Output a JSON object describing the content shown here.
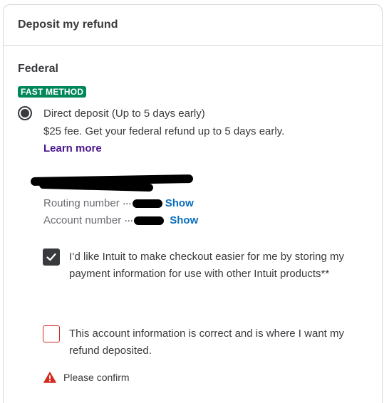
{
  "card": {
    "title": "Deposit my refund"
  },
  "federal": {
    "heading": "Federal",
    "badge": "FAST METHOD",
    "option": {
      "title": "Direct deposit (Up to 5 days early)",
      "description": "$25 fee. Get your federal refund up to 5 days early.",
      "learn_more": "Learn more",
      "selected": true
    },
    "account": {
      "routing_label": "Routing number",
      "account_label": "Account number",
      "mask": "···",
      "show_label": "Show"
    },
    "consent": {
      "label": "I’d like Intuit to make checkout easier for me by storing my payment information for use with other Intuit products**",
      "checked": true
    },
    "confirm": {
      "label": "This account information is correct and is where I want my refund deposited.",
      "checked": false
    },
    "error": {
      "message": "Please confirm",
      "icon": "warning-triangle-icon",
      "color": "#d52b1e"
    }
  },
  "colors": {
    "badge": "#00875a",
    "link": "#4a148c",
    "show_link": "#0a6ebd",
    "text": "#393a3d"
  }
}
